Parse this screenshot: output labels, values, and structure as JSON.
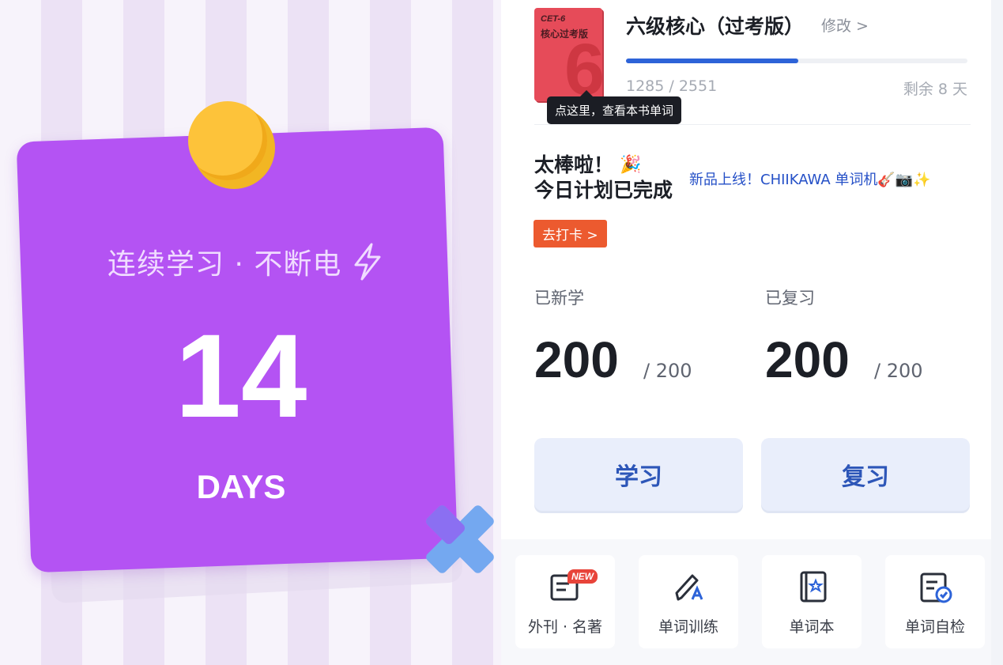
{
  "streak": {
    "label": "连续学习 · 不断电",
    "days": "14",
    "unit": "DAYS"
  },
  "book": {
    "cover_tag": "CET-6",
    "cover_title": "核心过考版",
    "cover_digit": "6",
    "name": "六级核心（过考版）",
    "edit_label": "修改 >",
    "tooltip": "点这里，查看本书单词",
    "progress_text": "1285 / 2551",
    "progress_fraction": 0.504,
    "days_left": "剩余 8 天"
  },
  "today": {
    "title": "太棒啦！",
    "subtitle": "今日计划已完成",
    "promo": "新品上线！CHIIKAWA 单词机🎸📷✨",
    "checkin_label": "去打卡 >"
  },
  "stats": {
    "learned_label": "已新学",
    "learned_value": "200",
    "learned_total": "/ 200",
    "reviewed_label": "已复习",
    "reviewed_value": "200",
    "reviewed_total": "/ 200"
  },
  "actions": {
    "study_label": "学习",
    "review_label": "复习"
  },
  "tools": {
    "badge": "NEW",
    "items": [
      "外刊 · 名著",
      "单词训练",
      "单词本",
      "单词自检"
    ]
  },
  "colors": {
    "streak_card": "#b453f3",
    "pin": "#fdc33a",
    "accent_blue": "#2d63d8",
    "checkin_orange": "#ec5a2f"
  }
}
